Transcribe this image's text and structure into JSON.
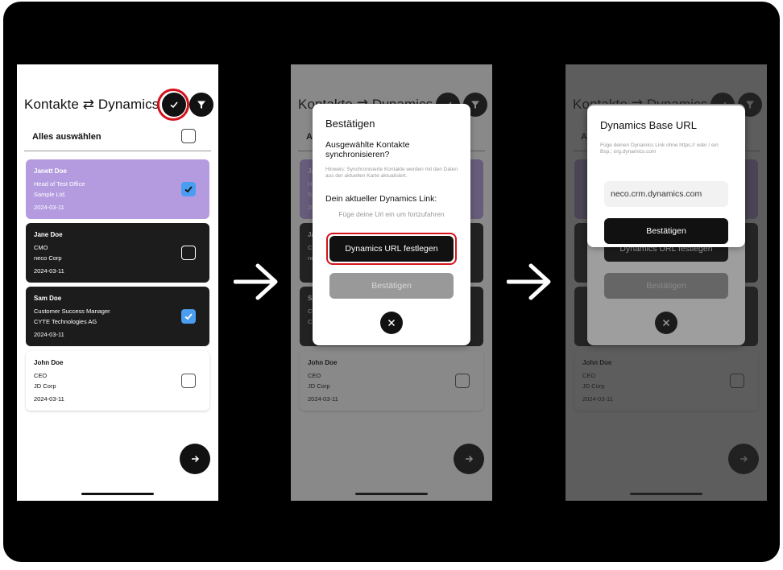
{
  "screen": {
    "title": "Kontakte ⇄ Dynamics",
    "select_all": "Alles auswählen",
    "contacts": [
      {
        "name": "Janett Doe",
        "role": "Head of Test Office",
        "company": "Sample Ltd.",
        "date": "2024-03-11",
        "selected": true,
        "style": "purple"
      },
      {
        "name": "Jane Doe",
        "role": "CMO",
        "company": "neco Corp",
        "date": "2024-03-11",
        "selected": false,
        "style": "dark"
      },
      {
        "name": "Sam Doe",
        "role": "Customer Success Manager",
        "company": "CYTE Technologies AG",
        "date": "2024-03-11",
        "selected": true,
        "style": "dark"
      },
      {
        "name": "John Doe",
        "role": "CEO",
        "company": "JD Corp",
        "date": "2024-03-11",
        "selected": false,
        "style": "light"
      }
    ]
  },
  "confirm_dialog": {
    "title": "Bestätigen",
    "question": "Ausgewählte Kontakte synchronisieren?",
    "hint": "Hinweis: Synchronisierte Kontakte werden mit den Daten aus der aktuellen Karte aktualisiert.",
    "link_label": "Dein aktueller Dynamics Link:",
    "link_placeholder": "Füge deine Url ein um fortzufahren",
    "set_url_button": "Dynamics URL festlegen",
    "confirm_button": "Bestätigen"
  },
  "url_dialog": {
    "title": "Dynamics Base URL",
    "hint": "Füge deinen Dynamics Link ohne https:// oder / ein\nBsp.: org.dynamics.com",
    "input_value": "neco.crm.dynamics.com",
    "confirm_button": "Bestätigen"
  },
  "colors": {
    "accent_purple": "#b49be0",
    "checkbox_blue": "#4a9df0",
    "highlight_red": "#d5121b",
    "dark_card": "#1c1c1c"
  }
}
